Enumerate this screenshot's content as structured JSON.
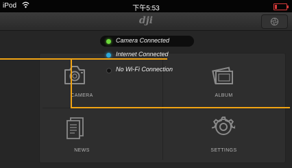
{
  "status_bar": {
    "device": "iPod",
    "time": "下午5:53"
  },
  "header": {
    "logo": "dji"
  },
  "connection": [
    {
      "label": "Camera Connected",
      "color": "#6cd93a"
    },
    {
      "label": "Internet Connected",
      "color": "#2fa8d8"
    },
    {
      "label": "No Wi-Fi Connection",
      "color": "#111111"
    }
  ],
  "tiles": {
    "camera": "CAMERA",
    "album": "ALBUM",
    "news": "NEWS",
    "settings": "SETTINGS"
  },
  "colors": {
    "callout": "#f2a413",
    "battery": "#e03a3a"
  }
}
